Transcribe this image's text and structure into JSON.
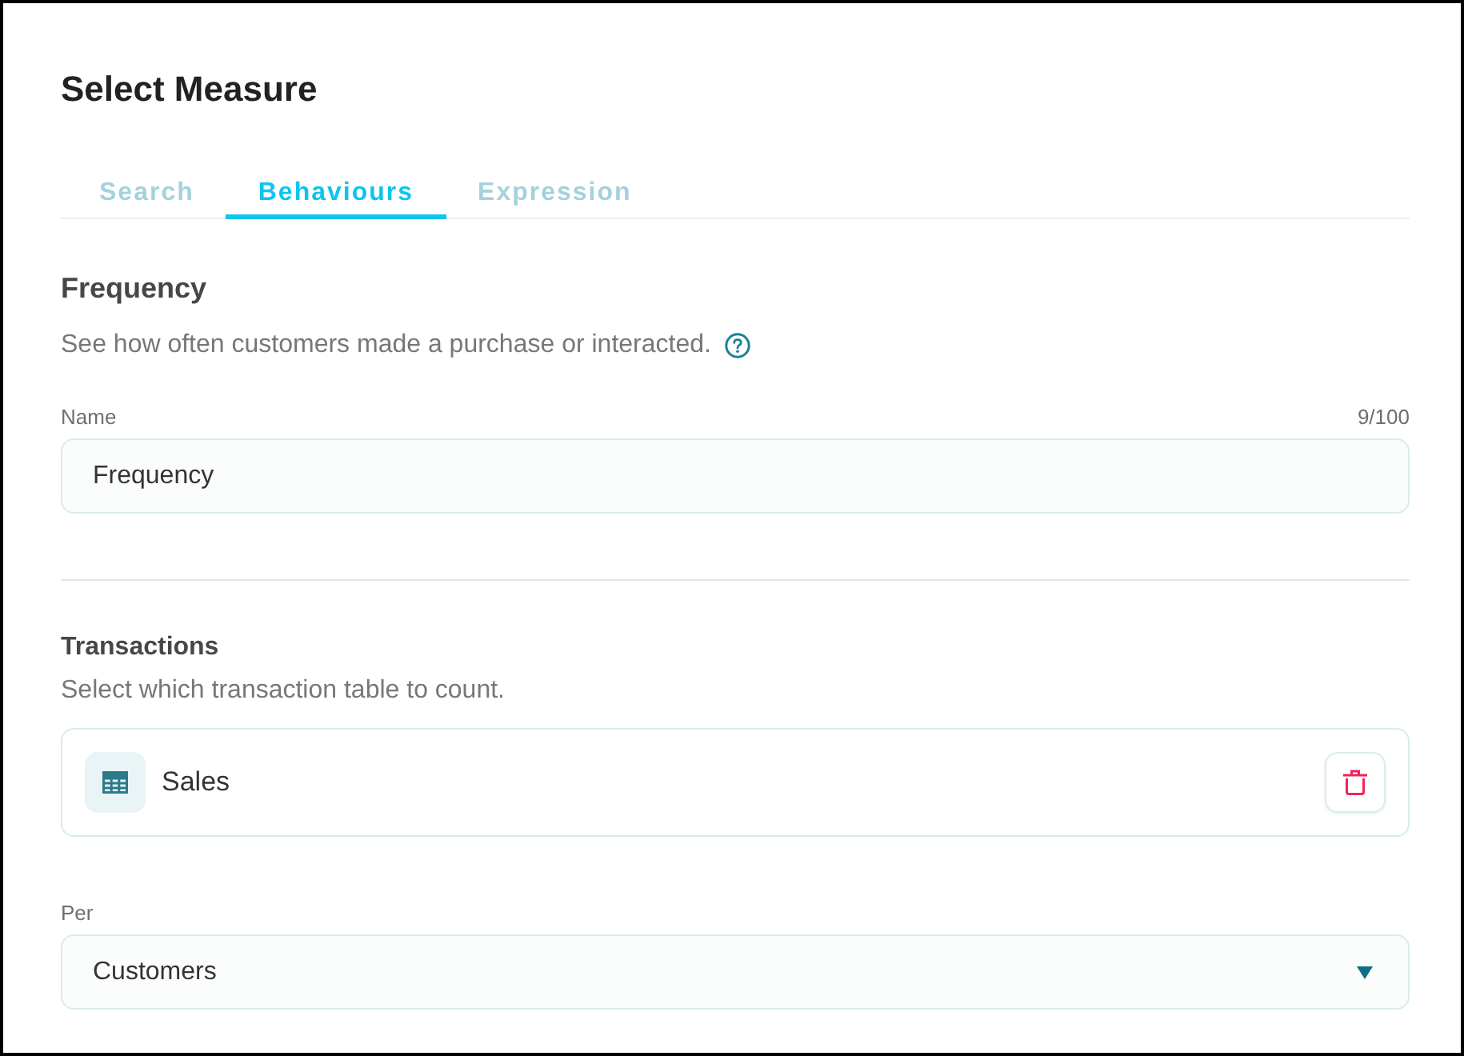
{
  "dialog": {
    "title": "Select Measure"
  },
  "tabs": [
    {
      "label": "Search",
      "selected": false
    },
    {
      "label": "Behaviours",
      "selected": true
    },
    {
      "label": "Expression",
      "selected": false
    }
  ],
  "measure": {
    "title": "Frequency",
    "description": "See how often customers made a purchase or interacted.",
    "name_field": {
      "label": "Name",
      "value": "Frequency",
      "counter": "9/100"
    }
  },
  "transactions": {
    "title": "Transactions",
    "description": "Select which transaction table to count.",
    "items": [
      {
        "label": "Sales"
      }
    ]
  },
  "per_field": {
    "label": "Per",
    "value": "Customers"
  }
}
